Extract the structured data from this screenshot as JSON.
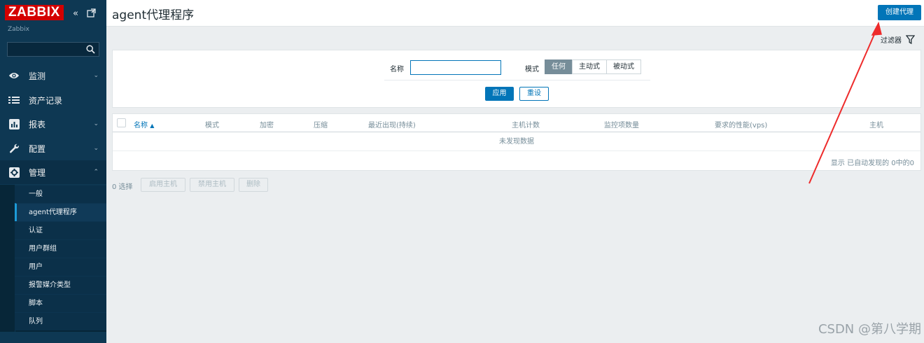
{
  "sidebar": {
    "logo": "ZABBIX",
    "collapse_icon": "«",
    "kiosk_icon": "⬚",
    "server_name": "Zabbix",
    "search": {
      "value": "",
      "placeholder": ""
    },
    "menu": [
      {
        "label": "监测",
        "icon": "eye-icon",
        "chevron": "⌄"
      },
      {
        "label": "资产记录",
        "icon": "list-icon",
        "chevron": "⌄"
      },
      {
        "label": "报表",
        "icon": "chart-icon",
        "chevron": "⌄"
      },
      {
        "label": "配置",
        "icon": "wrench-icon",
        "chevron": "⌄"
      },
      {
        "label": "管理",
        "icon": "gear-icon",
        "chevron": "⌃"
      }
    ],
    "submenu": [
      {
        "label": "一般"
      },
      {
        "label": "agent代理程序"
      },
      {
        "label": "认证"
      },
      {
        "label": "用户群组"
      },
      {
        "label": "用户"
      },
      {
        "label": "报警媒介类型"
      },
      {
        "label": "脚本"
      },
      {
        "label": "队列"
      }
    ]
  },
  "header": {
    "title": "agent代理程序",
    "create_button": "创建代理"
  },
  "filter": {
    "tab_label": "过滤器",
    "name_label": "名称",
    "name_value": "",
    "mode_label": "模式",
    "mode_options": [
      "任何",
      "主动式",
      "被动式"
    ],
    "mode_selected": "任何",
    "apply": "应用",
    "reset": "重设"
  },
  "table": {
    "columns": [
      "名称",
      "模式",
      "加密",
      "压缩",
      "最近出现(持续)",
      "主机计数",
      "监控项数量",
      "要求的性能(vps)",
      "主机"
    ],
    "sort_indicator": "▲",
    "empty_text": "未发现数据",
    "count_text": "显示 已自动发现的 0中的0"
  },
  "actions": {
    "selected": "0 选择",
    "enable_hosts": "启用主机",
    "disable_hosts": "禁用主机",
    "delete": "删除"
  },
  "colors": {
    "sidebar_bg": "#0e3853",
    "accent": "#0275b8",
    "logo_red": "#d40000",
    "annotation_red": "#ee2b2b"
  },
  "watermark": "CSDN @第八学期"
}
